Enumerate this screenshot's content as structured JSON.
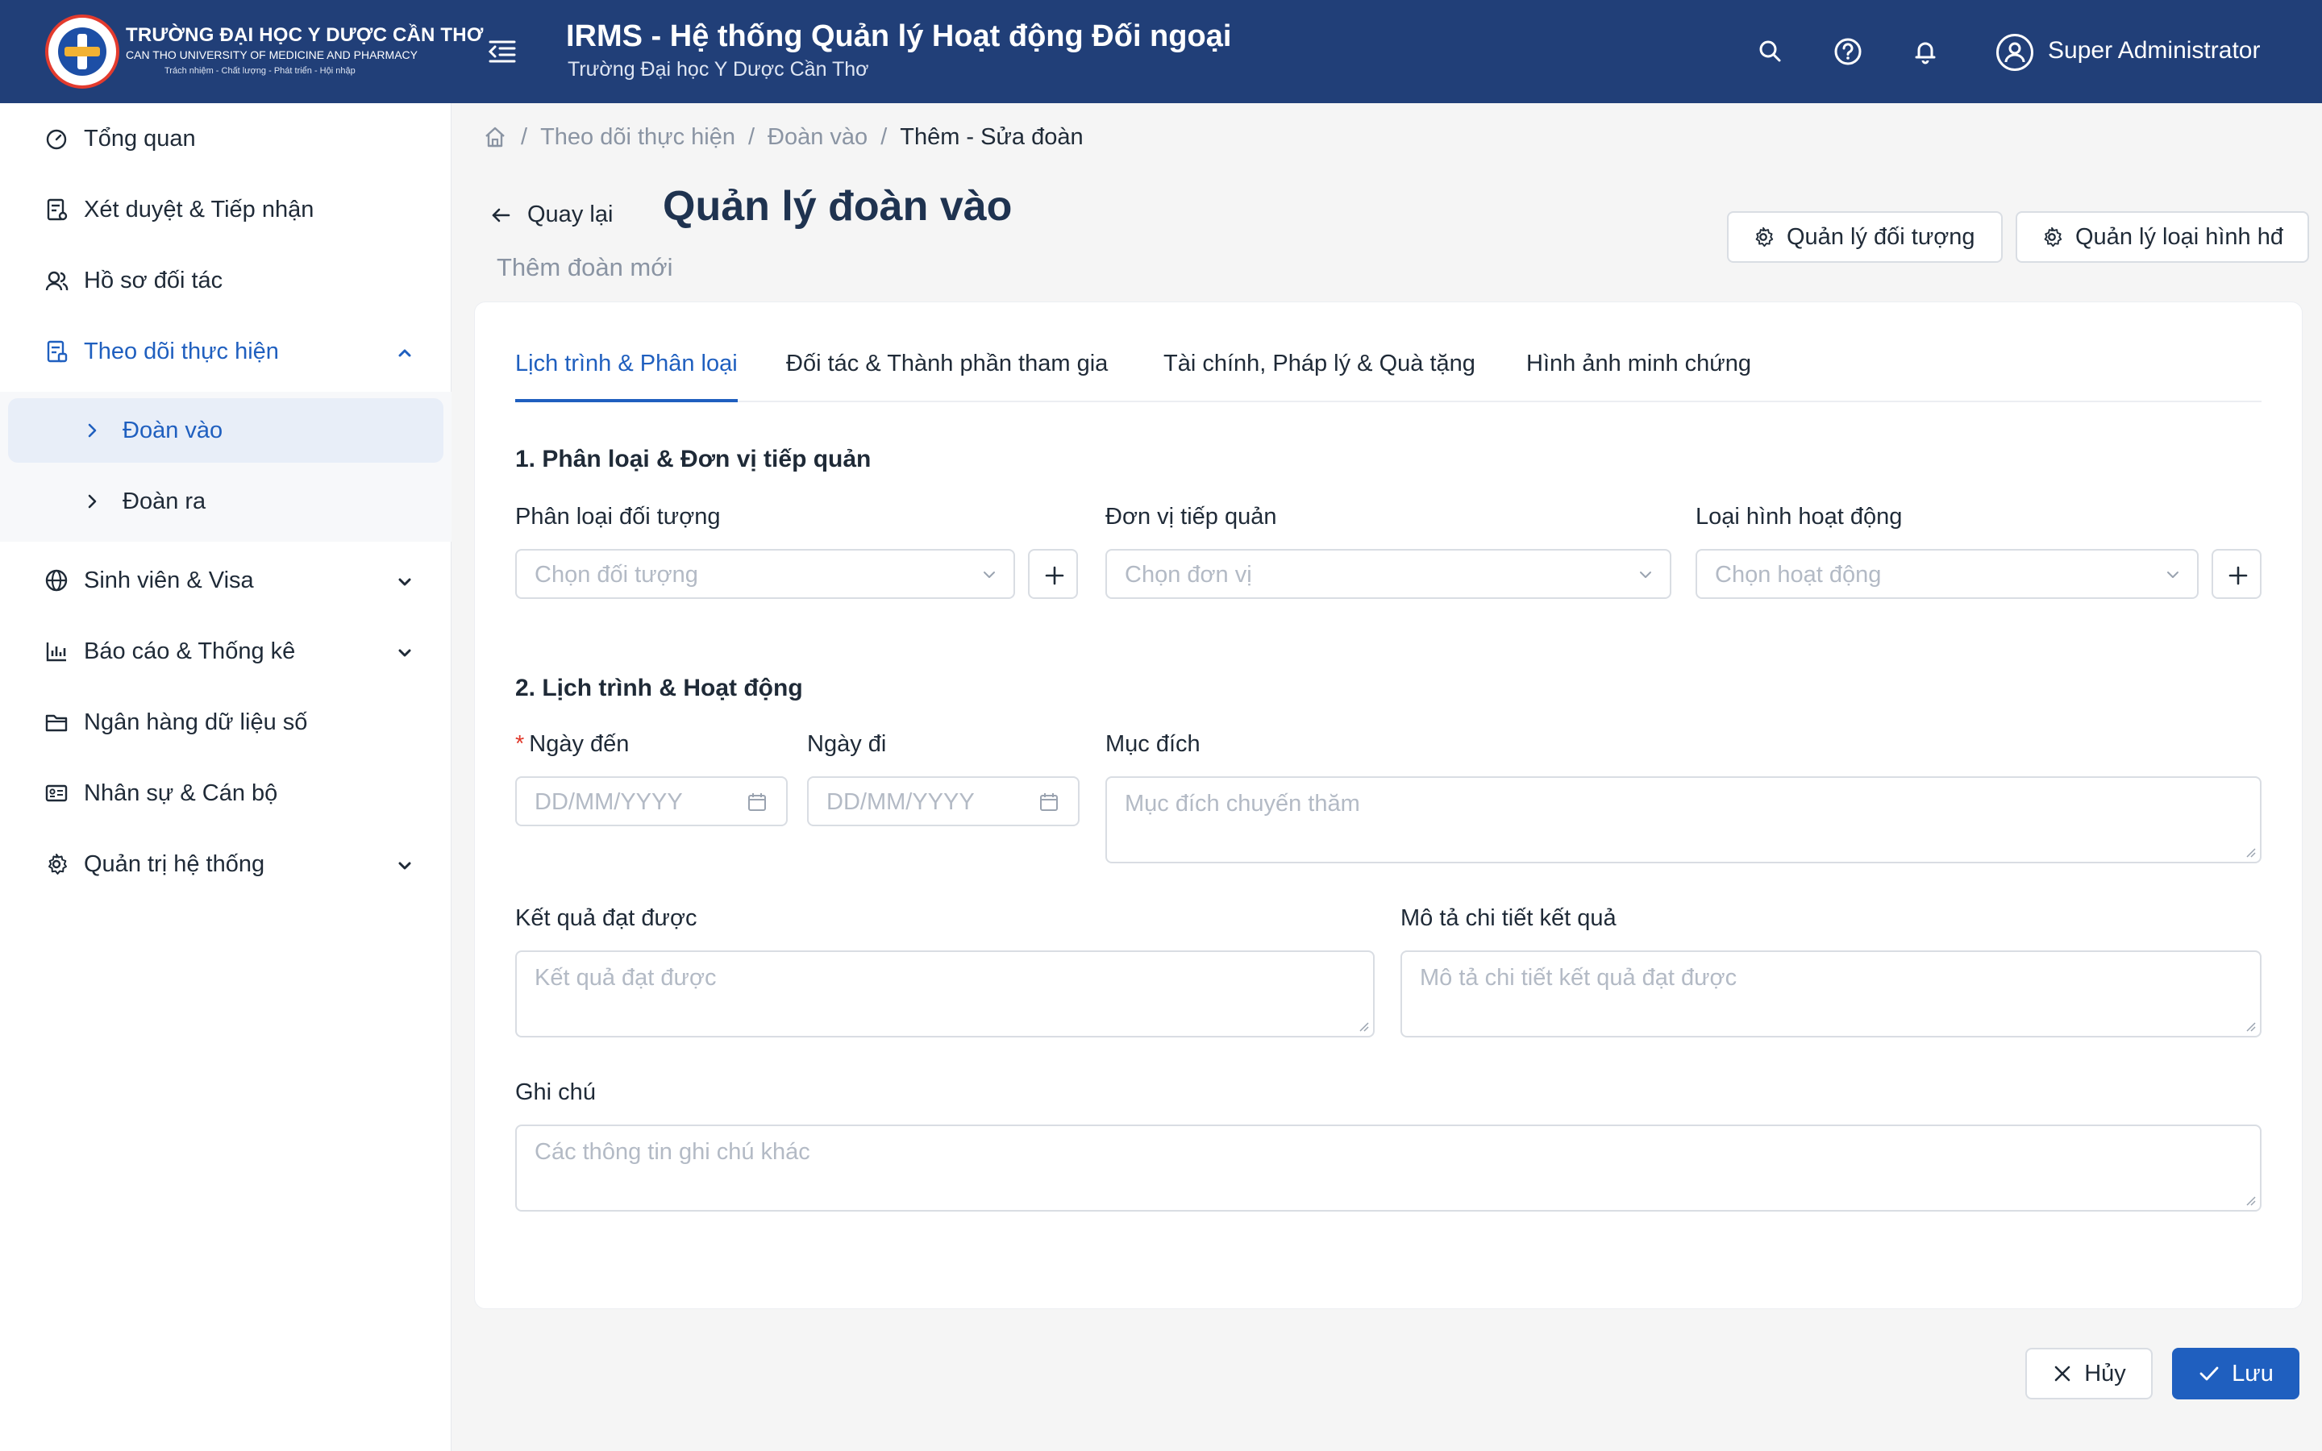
{
  "header": {
    "logo_line1": "TRƯỜNG ĐẠI HỌC Y DƯỢC CẦN THƠ",
    "logo_line2": "CAN THO UNIVERSITY OF MEDICINE AND PHARMACY",
    "logo_line3": "Trách nhiệm - Chất lượng - Phát triển - Hội nhập",
    "title": "IRMS - Hệ thống Quản lý Hoạt động Đối ngoại",
    "subtitle": "Trường Đại học Y Dược Cần Thơ",
    "user_name": "Super Administrator"
  },
  "sidebar": {
    "items": [
      {
        "label": "Tổng quan",
        "icon": "dashboard-icon"
      },
      {
        "label": "Xét duyệt & Tiếp nhận",
        "icon": "approval-icon"
      },
      {
        "label": "Hồ sơ đối tác",
        "icon": "partners-icon"
      },
      {
        "label": "Theo dõi thực hiện",
        "icon": "tracking-icon"
      },
      {
        "label": "Sinh viên & Visa",
        "icon": "globe-icon"
      },
      {
        "label": "Báo cáo & Thống kê",
        "icon": "chart-icon"
      },
      {
        "label": "Ngân hàng dữ liệu số",
        "icon": "folder-icon"
      },
      {
        "label": "Nhân sự & Cán bộ",
        "icon": "id-card-icon"
      },
      {
        "label": "Quản trị hệ thống",
        "icon": "gear-icon"
      }
    ],
    "sub_items": [
      {
        "label": "Đoàn vào"
      },
      {
        "label": "Đoàn ra"
      }
    ]
  },
  "breadcrumb": {
    "items": [
      "Theo dõi thực hiện",
      "Đoàn vào",
      "Thêm - Sửa đoàn"
    ]
  },
  "page": {
    "back_label": "Quay lại",
    "title": "Quản lý đoàn vào",
    "subtitle": "Thêm đoàn mới",
    "btn_manage_objects": "Quản lý đối tượng",
    "btn_manage_activity_types": "Quản lý loại hình hđ"
  },
  "tabs": [
    {
      "label": "Lịch trình & Phân loại"
    },
    {
      "label": "Đối tác & Thành phần tham gia"
    },
    {
      "label": "Tài chính, Pháp lý & Quà tặng"
    },
    {
      "label": "Hình ảnh minh chứng"
    }
  ],
  "form": {
    "section1_title": "1. Phân loại & Đơn vị tiếp quản",
    "object_type_label": "Phân loại đối tượng",
    "object_type_placeholder": "Chọn đối tượng",
    "host_unit_label": "Đơn vị tiếp quản",
    "host_unit_placeholder": "Chọn đơn vị",
    "activity_type_label": "Loại hình hoạt động",
    "activity_type_placeholder": "Chọn hoạt động",
    "section2_title": "2. Lịch trình & Hoạt động",
    "arrival_label": "Ngày đến",
    "arrival_placeholder": "DD/MM/YYYY",
    "departure_label": "Ngày đi",
    "departure_placeholder": "DD/MM/YYYY",
    "purpose_label": "Mục đích",
    "purpose_placeholder": "Mục đích chuyến thăm",
    "result_label": "Kết quả đạt được",
    "result_placeholder": "Kết quả đạt được",
    "result_detail_label": "Mô tả chi tiết kết quả",
    "result_detail_placeholder": "Mô tả chi tiết kết quả đạt được",
    "note_label": "Ghi chú",
    "note_placeholder": "Các thông tin ghi chú khác"
  },
  "footer": {
    "cancel_label": "Hủy",
    "save_label": "Lưu"
  },
  "colors": {
    "header_bg": "#213f78",
    "accent": "#1f5fbf",
    "required": "#e0392b"
  }
}
